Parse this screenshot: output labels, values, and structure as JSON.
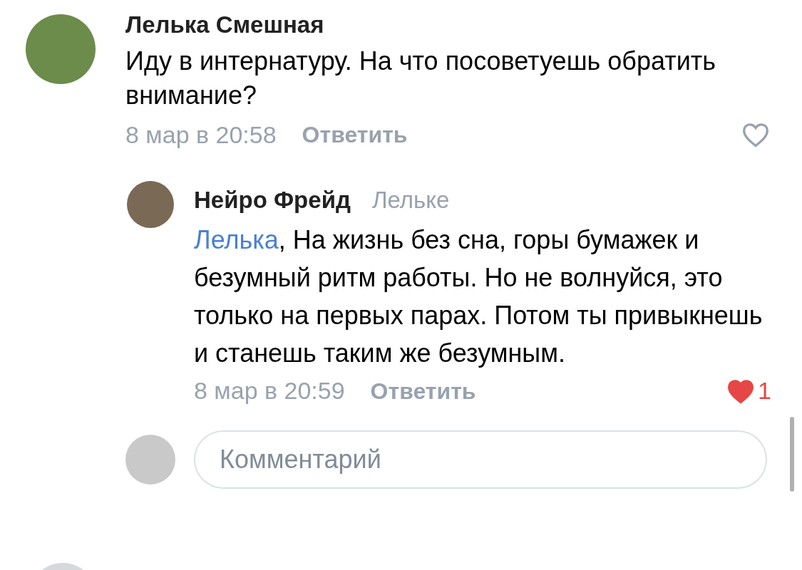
{
  "comment": {
    "author": "Лелька Смешная",
    "text": "Иду в интернатуру. На что посоветуешь обратить внимание?",
    "time": "8 мар в 20:58",
    "reply_label": "Ответить",
    "liked": false
  },
  "reply": {
    "author": "Нейро Фрейд",
    "to": "Лельке",
    "mention": "Лелька",
    "text": ", На жизнь без сна, горы бумажек и безумный ритм работы. Но не волнуйся, это только на первых парах. Потом ты привыкнешь и станешь таким же безумным.",
    "time": "8 мар в 20:59",
    "reply_label": "Ответить",
    "liked": true,
    "likes": "1"
  },
  "composer": {
    "placeholder": "Комментарий"
  }
}
